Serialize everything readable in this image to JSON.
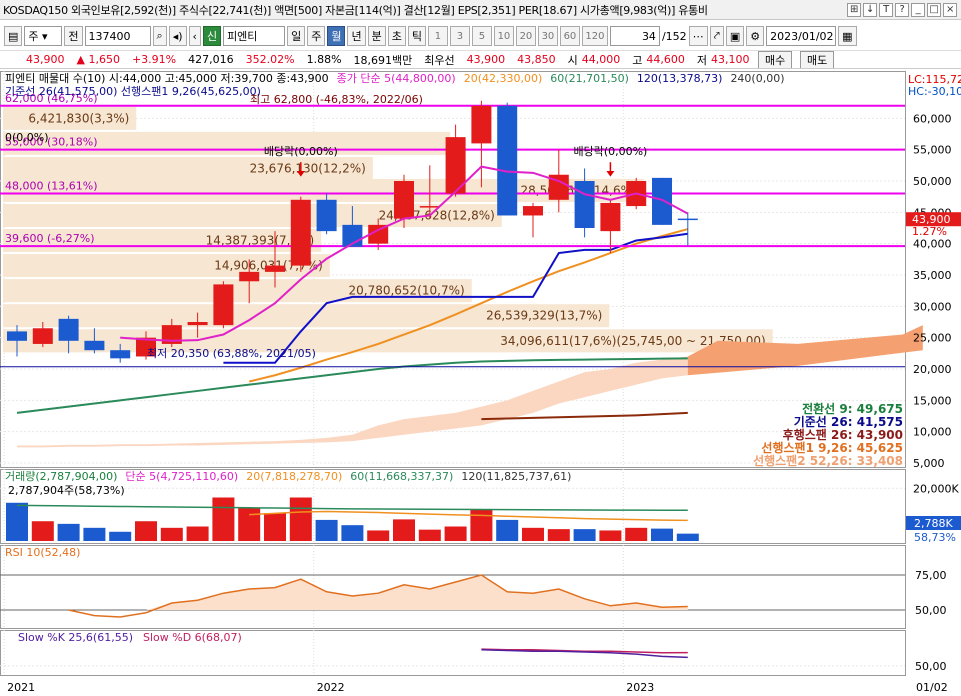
{
  "titlebar": {
    "text": "KOSDAQ150 외국인보유[2,592(천)] 주식수[22,741(천)] 액면[500] 자본금[114(억)] 결산[12월] EPS[2,351] PER[18.67] 시가총액[9,983(억)] 유통비",
    "icons": [
      "⊞",
      "↓",
      "T",
      "?",
      "_",
      "□",
      "×"
    ]
  },
  "toolbar": {
    "market": "주",
    "range": "전",
    "code": "137400",
    "name_prefix": "신",
    "name": "피엔티",
    "periods": [
      "일",
      "주",
      "월",
      "년",
      "분",
      "초",
      "틱"
    ],
    "active_period": "월",
    "minutes": [
      "1",
      "3",
      "5",
      "10",
      "20",
      "30",
      "60",
      "120"
    ],
    "counter": "34",
    "total": "/152",
    "date": "2023/01/02"
  },
  "quote": {
    "price": "43,900",
    "change": "1,650",
    "pct": "+3.91%",
    "volume": "427,016",
    "vol_pct": "352.02%",
    "ratio": "1.88%",
    "amount": "18,691백만",
    "bid_label": "최우선",
    "bid": "43,900",
    "ask": "43,850",
    "open_label": "시",
    "open": "44,000",
    "high_label": "고",
    "high": "44,600",
    "low_label": "저",
    "low": "43,100",
    "buy": "매수",
    "sell": "매도"
  },
  "chart_data": {
    "type": "candlestick",
    "main": {
      "legend_line1": "피엔티 매물대 수(10) 시:44,000 고:45,000 저:39,700 종:43,900",
      "legend_ma": "종가 단순 5(44,800,00)",
      "legend_ma20": "20(42,330,00)",
      "legend_ma60": "60(21,701,50)",
      "legend_ma120": "120(13,378,73)",
      "legend_ma240": "240(0,00)",
      "legend_line2": "기준선 26(41,575,00) 선행스팬1 9,26(45,625,00)",
      "right_top_1": "LC:115,72",
      "right_top_2": "HC:-30,10",
      "price_tag": "43,900",
      "pct_tag": "1.27%",
      "ylim": [
        5000,
        65000
      ],
      "y_ticks": [
        60000,
        55000,
        50000,
        45000,
        40000,
        35000,
        30000,
        25000,
        20000,
        15000,
        10000,
        5000
      ],
      "y_tick_labels": [
        "60,000",
        "55,000",
        "50,000",
        "45,000",
        "40,000",
        "35,000",
        "30,000",
        "25,000",
        "20,000",
        "15,000",
        "10,000",
        "5,000"
      ],
      "hlines": [
        {
          "price": 62000,
          "label": "62,000 (46,75%)"
        },
        {
          "price": 55000,
          "label": "55,000 (30,18%)"
        },
        {
          "price": 48000,
          "label": "48,000 (13,61%)"
        },
        {
          "price": 39600,
          "label": "39,600 (-6,27%)"
        }
      ],
      "zero_label": "0(0,0%)",
      "high_label": "최고 62,800 (-46,83%, 2022/06)",
      "low_label": "최저 20,350 (63,88%, 2021/05)",
      "dividend_labels": [
        {
          "text": "배당락(0,00%)",
          "i": 11
        },
        {
          "text": "배당락(0,00%)",
          "i": 23
        }
      ],
      "volume_profile": [
        {
          "price": 60000,
          "w": 0.155,
          "text": "6,421,830(3,3%)"
        },
        {
          "price": 56000,
          "w": 0.52,
          "text": ""
        },
        {
          "price": 52000,
          "w": 0.43,
          "text": "23,676,130(12,2%)"
        },
        {
          "price": 48500,
          "w": 0.745,
          "text": "28,509,625(14,6%)"
        },
        {
          "price": 44500,
          "w": 0.58,
          "text": "24,787,628(12,8%)"
        },
        {
          "price": 40500,
          "w": 0.37,
          "text": "14,387,393(7,4%)"
        },
        {
          "price": 36500,
          "w": 0.38,
          "text": "14,906,031(7,7%)"
        },
        {
          "price": 32500,
          "w": 0.545,
          "text": "20,780,652(10,7%)"
        },
        {
          "price": 28500,
          "w": 0.705,
          "text": "26,539,329(13,7%)"
        },
        {
          "price": 24500,
          "w": 0.895,
          "text": "34,096,611(17,6%)(25,745,00 ~ 21,750,00)"
        }
      ],
      "candles": [
        [
          26000,
          27000,
          22000,
          24500
        ],
        [
          24000,
          27500,
          23500,
          26500
        ],
        [
          28000,
          28500,
          22500,
          24500
        ],
        [
          24500,
          26500,
          22500,
          23000
        ],
        [
          23000,
          24000,
          21000,
          21700
        ],
        [
          22000,
          26000,
          21500,
          25000
        ],
        [
          24000,
          28000,
          23500,
          27000
        ],
        [
          27000,
          29000,
          25000,
          27500
        ],
        [
          27000,
          34000,
          26500,
          33500
        ],
        [
          34000,
          37500,
          30500,
          35500
        ],
        [
          35500,
          42000,
          33000,
          36500
        ],
        [
          36500,
          47500,
          35500,
          47000
        ],
        [
          47000,
          48000,
          41500,
          42000
        ],
        [
          43000,
          46000,
          39500,
          39500
        ],
        [
          40000,
          44000,
          39000,
          43000
        ],
        [
          44000,
          51000,
          42500,
          50000
        ],
        [
          46000,
          52500,
          44000,
          46000
        ],
        [
          48000,
          59000,
          47500,
          57000
        ],
        [
          56000,
          62800,
          49000,
          62000
        ],
        [
          62000,
          62500,
          46500,
          44500
        ],
        [
          44500,
          46500,
          41000,
          46000
        ],
        [
          47000,
          55000,
          45000,
          51000
        ],
        [
          50000,
          52000,
          41000,
          42500
        ],
        [
          42000,
          47000,
          38500,
          46500
        ],
        [
          46000,
          50500,
          45500,
          50000
        ],
        [
          50500,
          50500,
          43000,
          43000
        ],
        [
          44000,
          45000,
          39700,
          43900
        ]
      ],
      "ma5": [
        null,
        null,
        null,
        null,
        25000,
        24700,
        24500,
        24600,
        25500,
        27800,
        30500,
        34300,
        37600,
        40000,
        42200,
        44000,
        44500,
        48300,
        52300,
        51500,
        51300,
        50000,
        47900,
        47000,
        48000,
        47000,
        44800
      ],
      "ma20": [
        null,
        null,
        null,
        null,
        null,
        null,
        null,
        null,
        null,
        18000,
        19000,
        20200,
        21500,
        22700,
        24000,
        25500,
        27000,
        28700,
        30500,
        32300,
        34000,
        35600,
        37000,
        38500,
        40000,
        41200,
        42330
      ],
      "ma60": [
        13000,
        13500,
        14000,
        14500,
        15000,
        15500,
        16000,
        16500,
        17000,
        17500,
        18000,
        18500,
        19000,
        19500,
        20000,
        20400,
        20700,
        21000,
        21200,
        21300,
        21400,
        21450,
        21500,
        21550,
        21600,
        21650,
        21701
      ],
      "kijun": [
        null,
        null,
        null,
        null,
        null,
        null,
        null,
        null,
        21000,
        21000,
        21000,
        26000,
        30500,
        31500,
        31500,
        31500,
        31500,
        31500,
        31500,
        31500,
        31500,
        38500,
        39000,
        39000,
        40500,
        41000,
        41575
      ],
      "senkou2_line": [
        null,
        null,
        null,
        null,
        null,
        null,
        null,
        null,
        null,
        null,
        null,
        null,
        null,
        null,
        null,
        null,
        null,
        null,
        12000,
        12100,
        12200,
        12300,
        12400,
        12500,
        12600,
        12800,
        13000
      ],
      "cloud_top": [
        7800,
        7800,
        7900,
        7900,
        8000,
        8000,
        8100,
        8200,
        8300,
        8400,
        8500,
        8700,
        9000,
        9500,
        11000,
        12000,
        12500,
        13000,
        14000,
        15000,
        16500,
        18000,
        19500,
        20000,
        21000,
        21500,
        22000
      ],
      "cloud_bottom": [
        7500,
        7500,
        7600,
        7600,
        7700,
        7700,
        7800,
        7800,
        7900,
        8000,
        8100,
        8200,
        8300,
        8500,
        9000,
        9500,
        10000,
        10500,
        11000,
        12000,
        13000,
        14500,
        15500,
        16500,
        17500,
        18500,
        19000
      ],
      "ichimoku_legend": [
        {
          "text": "전환선 9: 49,675",
          "color": "#1a7f3c"
        },
        {
          "text": "기준선 26: 41,575",
          "color": "#0a0a8a"
        },
        {
          "text": "후행스팬 26: 43,900",
          "color": "#8b1a1a"
        },
        {
          "text": "선행스팬1 9,26: 45,625",
          "color": "#e07020"
        },
        {
          "text": "선행스팬2 52,26: 33,408",
          "color": "#f0a070"
        }
      ]
    },
    "volume": {
      "legend": "거래량(2,787,904,00)",
      "legend_ma5": "단순 5(4,725,110,60)",
      "legend_ma20": "20(7,818,278,70)",
      "legend_ma60": "60(11,668,337,37)",
      "legend_ma120": "120(11,825,737,61)",
      "last_label": "2,787,904주(58,73%)",
      "tag": "2,788K",
      "pct": "58,73%",
      "ylim": [
        0,
        22000
      ],
      "tick": 20000,
      "tick_label": "20,000K",
      "bars": [
        14500,
        7500,
        6500,
        5000,
        3500,
        7500,
        5000,
        5500,
        16500,
        12500,
        10500,
        16500,
        8000,
        6000,
        4000,
        8200,
        4300,
        5500,
        12000,
        8000,
        5000,
        4500,
        4500,
        4000,
        5000,
        4700,
        2788
      ],
      "ma20": [
        null,
        null,
        null,
        null,
        null,
        null,
        null,
        null,
        null,
        10000,
        10500,
        11000,
        11200,
        11000,
        10800,
        10500,
        10200,
        9900,
        9700,
        9400,
        9100,
        8800,
        8500,
        8300,
        8100,
        7900,
        7818
      ],
      "ma60": [
        13500,
        13400,
        13300,
        13200,
        13100,
        13000,
        12900,
        12800,
        12700,
        12600,
        12500,
        12400,
        12300,
        12200,
        12150,
        12100,
        12050,
        12000,
        11950,
        11900,
        11850,
        11800,
        11750,
        11720,
        11700,
        11680,
        11668
      ]
    },
    "rsi": {
      "legend": "RSI 10(52,48)",
      "ylim": [
        40,
        85
      ],
      "ticks": [
        75,
        50
      ],
      "tick_labels": [
        "75,00",
        "50,00"
      ],
      "values": [
        null,
        null,
        50,
        46,
        45,
        48,
        55,
        57,
        62,
        65,
        66,
        72,
        63,
        60,
        62,
        68,
        65,
        70,
        75,
        63,
        62,
        65,
        58,
        53,
        55,
        52,
        52.48
      ]
    },
    "stoch": {
      "legend_k": "Slow %K 25,6(61,55)",
      "legend_d": "Slow %D 6(68,07)",
      "ylim": [
        40,
        80
      ],
      "tick": 50,
      "tick_label": "50,00",
      "k": [
        null,
        null,
        null,
        null,
        null,
        null,
        null,
        null,
        null,
        null,
        null,
        null,
        null,
        null,
        null,
        null,
        null,
        null,
        72,
        71,
        70,
        70,
        69,
        68,
        66,
        63,
        61.55
      ],
      "d": [
        null,
        null,
        null,
        null,
        null,
        null,
        null,
        null,
        null,
        null,
        null,
        null,
        null,
        null,
        null,
        null,
        null,
        null,
        73,
        72,
        72,
        71,
        70,
        70,
        69,
        68,
        68.07
      ]
    },
    "x_labels": [
      {
        "text": "2021",
        "i": 0
      },
      {
        "text": "2022",
        "i": 12
      },
      {
        "text": "2023",
        "i": 24
      }
    ],
    "x_end_label": "01/02"
  },
  "colors": {
    "up": "#e31b1b",
    "down": "#1c5bcf",
    "ma5": "#e020c8",
    "ma20": "#f09020",
    "ma60": "#2a8a5a",
    "kijun": "#1010c8",
    "hline": "#ee00ee",
    "profile": "#f6e6d2",
    "cloud": "#f4a070",
    "senkou2": "#8b2a0a"
  }
}
